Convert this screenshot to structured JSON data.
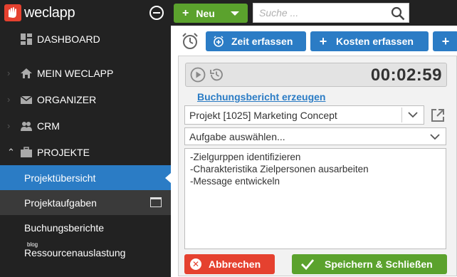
{
  "brand": {
    "name": "weclapp",
    "logo_color": "#e5412f"
  },
  "sidebar": {
    "collapse_icon": "minus-circle-icon",
    "items": [
      {
        "label": "DASHBOARD",
        "icon": "dashboard-icon"
      },
      {
        "label": "MEIN WECLAPP",
        "icon": "home-icon"
      },
      {
        "label": "ORGANIZER",
        "icon": "envelope-icon"
      },
      {
        "label": "CRM",
        "icon": "people-icon"
      },
      {
        "label": "PROJEKTE",
        "icon": "briefcase-icon"
      }
    ],
    "subitems": [
      {
        "label": "Projektübersicht"
      },
      {
        "label": "Projektaufgaben"
      },
      {
        "label": "Buchungsberichte"
      },
      {
        "label": "Ressourcenauslastung"
      }
    ],
    "small_tag": "blog"
  },
  "topbar": {
    "new_button": "Neu",
    "search_placeholder": "Suche ..."
  },
  "toolbar": {
    "zeit_button": "Zeit erfassen",
    "kosten_button": "Kosten erfassen",
    "more_button": "+"
  },
  "timer": {
    "time": "00:02:59"
  },
  "form": {
    "report_link": "Buchungsbericht erzeugen",
    "project_value": "Projekt [1025] Marketing Concept",
    "task_value": "Aufgabe auswählen...",
    "notes_lines": [
      "-Zielgurppen identifizieren",
      "-Charakteristika Zielpersonen ausarbeiten",
      "-Message entwickeln"
    ],
    "cancel_button": "Abbrechen",
    "save_button": "Speichern & Schließen"
  },
  "colors": {
    "sidebar_bg": "#222222",
    "accent_blue": "#2b7cc5",
    "accent_green": "#5ba22d",
    "accent_red": "#e5412f"
  }
}
